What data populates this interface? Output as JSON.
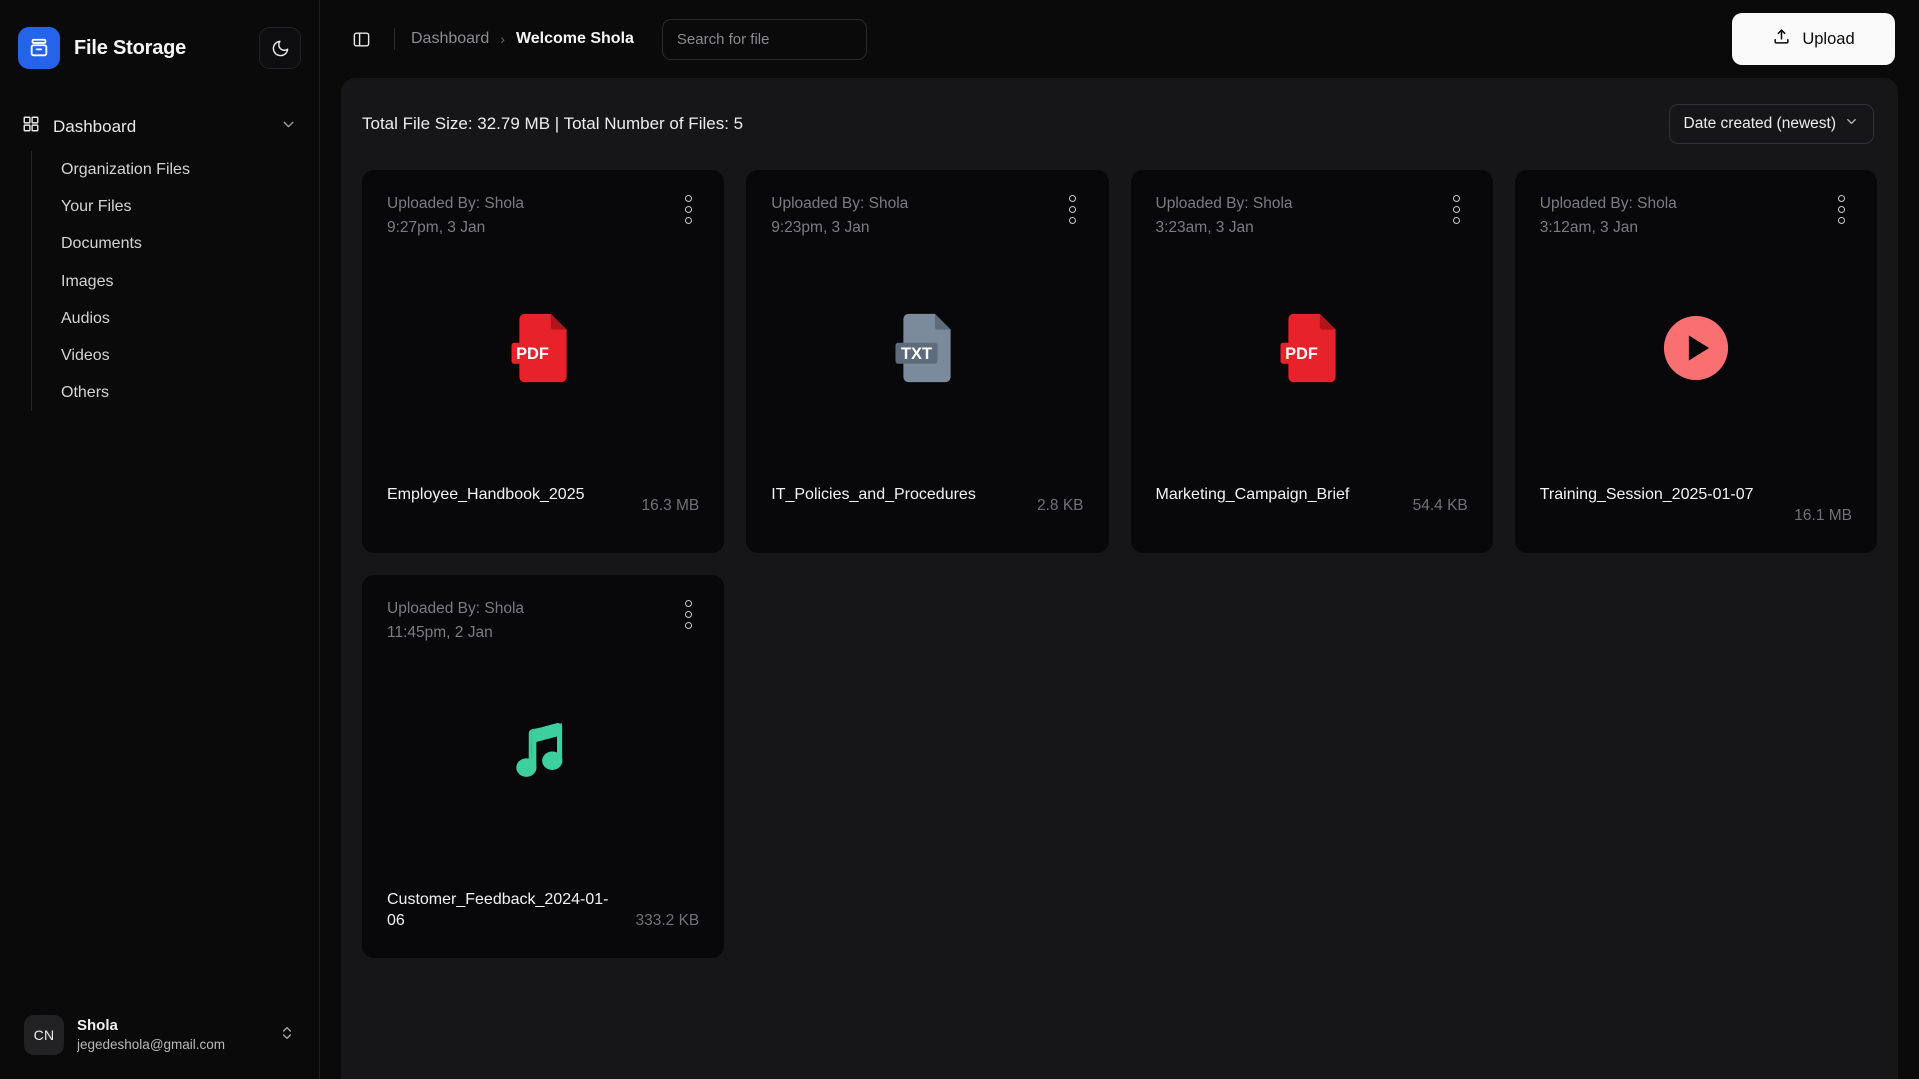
{
  "app": {
    "brand_name": "File Storage",
    "logo_icon": "archive-box-icon",
    "theme_toggle_icon": "moon-icon"
  },
  "sidebar": {
    "group": {
      "label": "Dashboard",
      "icon": "grid-icon",
      "chevron_icon": "chevron-down-icon"
    },
    "items": [
      {
        "label": "Organization Files"
      },
      {
        "label": "Your Files"
      },
      {
        "label": "Documents"
      },
      {
        "label": "Images"
      },
      {
        "label": "Audios"
      },
      {
        "label": "Videos"
      },
      {
        "label": "Others"
      }
    ],
    "user": {
      "initials": "CN",
      "name": "Shola",
      "email": "jegedeshola@gmail.com",
      "chevron_icon": "chevrons-up-down-icon"
    }
  },
  "topbar": {
    "panel_toggle_icon": "sidebar-toggle-icon",
    "breadcrumb": {
      "parent": "Dashboard",
      "separator": "›",
      "current": "Welcome Shola"
    },
    "search": {
      "value": "",
      "placeholder": "Search for file"
    },
    "upload": {
      "label": "Upload",
      "icon": "upload-icon"
    }
  },
  "panel": {
    "stats": "Total File Size: 32.79 MB | Total Number of Files: 5",
    "sort": {
      "label": "Date created (newest)",
      "icon": "chevron-down-icon"
    }
  },
  "colors": {
    "accent_blue": "#2563eb",
    "pdf_red": "#e8222a",
    "txt_slate": "#7b8b9c",
    "video_coral": "#fa7070",
    "audio_teal": "#3ecf9e",
    "upload_button": "#fafafa",
    "page_bg": "#0a0a0b",
    "panel_bg": "#161618",
    "card_bg": "#08080a"
  },
  "files": [
    {
      "uploader": "Uploaded By: Shola",
      "time": "9:27pm, 3 Jan",
      "name": "Employee_Handbook_2025",
      "size": "16.3 MB",
      "icon": "pdf-file-icon",
      "badge": "PDF",
      "wrap": false
    },
    {
      "uploader": "Uploaded By: Shola",
      "time": "9:23pm, 3 Jan",
      "name": "IT_Policies_and_Procedures",
      "size": "2.8 KB",
      "icon": "txt-file-icon",
      "badge": "TXT",
      "wrap": false
    },
    {
      "uploader": "Uploaded By: Shola",
      "time": "3:23am, 3 Jan",
      "name": "Marketing_Campaign_Brief",
      "size": "54.4 KB",
      "icon": "pdf-file-icon",
      "badge": "PDF",
      "wrap": false
    },
    {
      "uploader": "Uploaded By: Shola",
      "time": "3:12am, 3 Jan",
      "name": "Training_Session_2025-01-07",
      "size": "16.1 MB",
      "icon": "video-play-icon",
      "badge": "",
      "wrap": true
    },
    {
      "uploader": "Uploaded By: Shola",
      "time": "11:45pm, 2 Jan",
      "name": "Customer_Feedback_2024-01-06",
      "size": "333.2 KB",
      "icon": "audio-music-note-icon",
      "badge": "",
      "wrap": true
    }
  ]
}
